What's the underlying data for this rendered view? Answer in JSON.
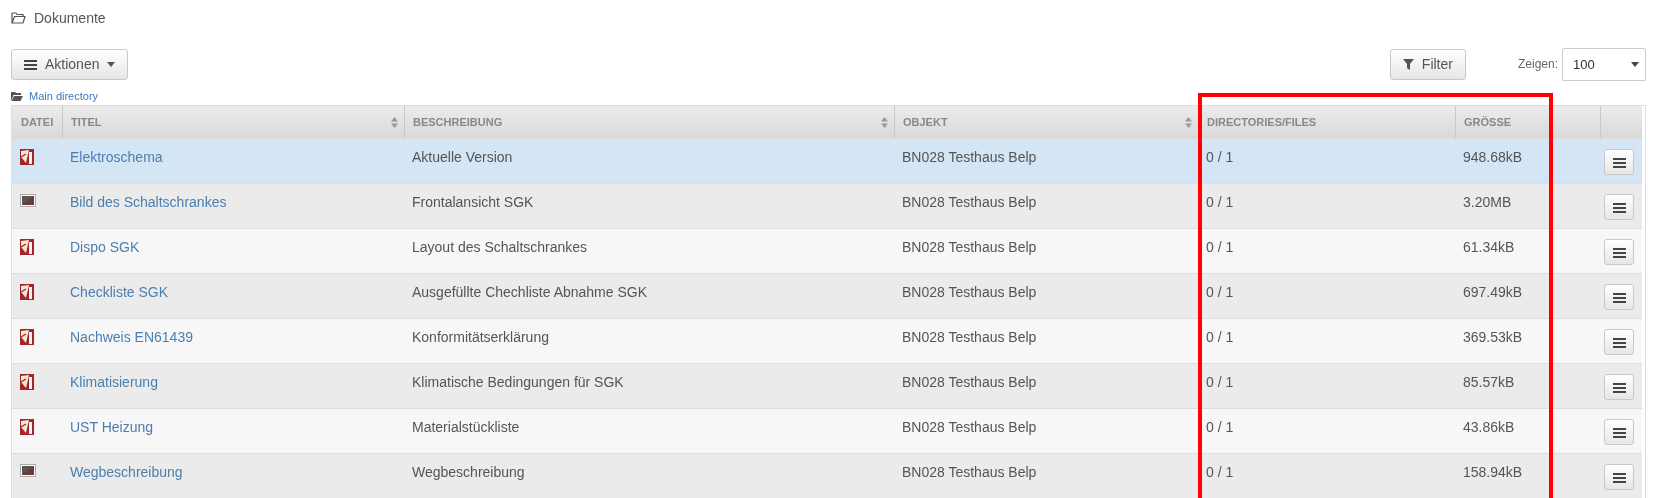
{
  "breadcrumb": "Dokumente",
  "actions_button": "Aktionen",
  "filter_button": "Filter",
  "page_size": {
    "label": "Zeigen:",
    "value": "100"
  },
  "directory": "Main directory",
  "table": {
    "columns": [
      {
        "label": "DATEI",
        "sortable": false,
        "highlighted": false
      },
      {
        "label": "TITEL",
        "sortable": true,
        "highlighted": false
      },
      {
        "label": "BESCHREIBUNG",
        "sortable": true,
        "highlighted": false
      },
      {
        "label": "OBJEKT",
        "sortable": true,
        "highlighted": false
      },
      {
        "label": "DIRECTORIES/FILES",
        "sortable": false,
        "highlighted": true
      },
      {
        "label": "GRÖSSE",
        "sortable": false,
        "highlighted": true
      }
    ],
    "rows": [
      {
        "kind": "pdf",
        "title": "Elektroschema",
        "description": "Aktuelle Version",
        "object": "BN028 Testhaus Belp",
        "counts": "0 / 1",
        "size": "948.68kB",
        "selected": true
      },
      {
        "kind": "image",
        "title": "Bild des Schaltschrankes",
        "description": "Frontalansicht SGK",
        "object": "BN028 Testhaus Belp",
        "counts": "0 / 1",
        "size": "3.20MB",
        "selected": false
      },
      {
        "kind": "pdf",
        "title": "Dispo SGK",
        "description": "Layout des Schaltschrankes",
        "object": "BN028 Testhaus Belp",
        "counts": "0 / 1",
        "size": "61.34kB",
        "selected": false
      },
      {
        "kind": "pdf",
        "title": "Checkliste SGK",
        "description": "Ausgefüllte Chechliste Abnahme SGK",
        "object": "BN028 Testhaus Belp",
        "counts": "0 / 1",
        "size": "697.49kB",
        "selected": false
      },
      {
        "kind": "pdf",
        "title": "Nachweis EN61439",
        "description": "Konformitätserklärung",
        "object": "BN028 Testhaus Belp",
        "counts": "0 / 1",
        "size": "369.53kB",
        "selected": false
      },
      {
        "kind": "pdf",
        "title": "Klimatisierung",
        "description": "Klimatische Bedingungen für SGK",
        "object": "BN028 Testhaus Belp",
        "counts": "0 / 1",
        "size": "85.57kB",
        "selected": false
      },
      {
        "kind": "pdf",
        "title": "UST Heizung",
        "description": "Materialstückliste",
        "object": "BN028 Testhaus Belp",
        "counts": "0 / 1",
        "size": "43.86kB",
        "selected": false
      },
      {
        "kind": "image",
        "title": "Wegbeschreibung",
        "description": "Wegbeschreibung",
        "object": "BN028 Testhaus Belp",
        "counts": "0 / 1",
        "size": "158.94kB",
        "selected": false
      }
    ]
  }
}
